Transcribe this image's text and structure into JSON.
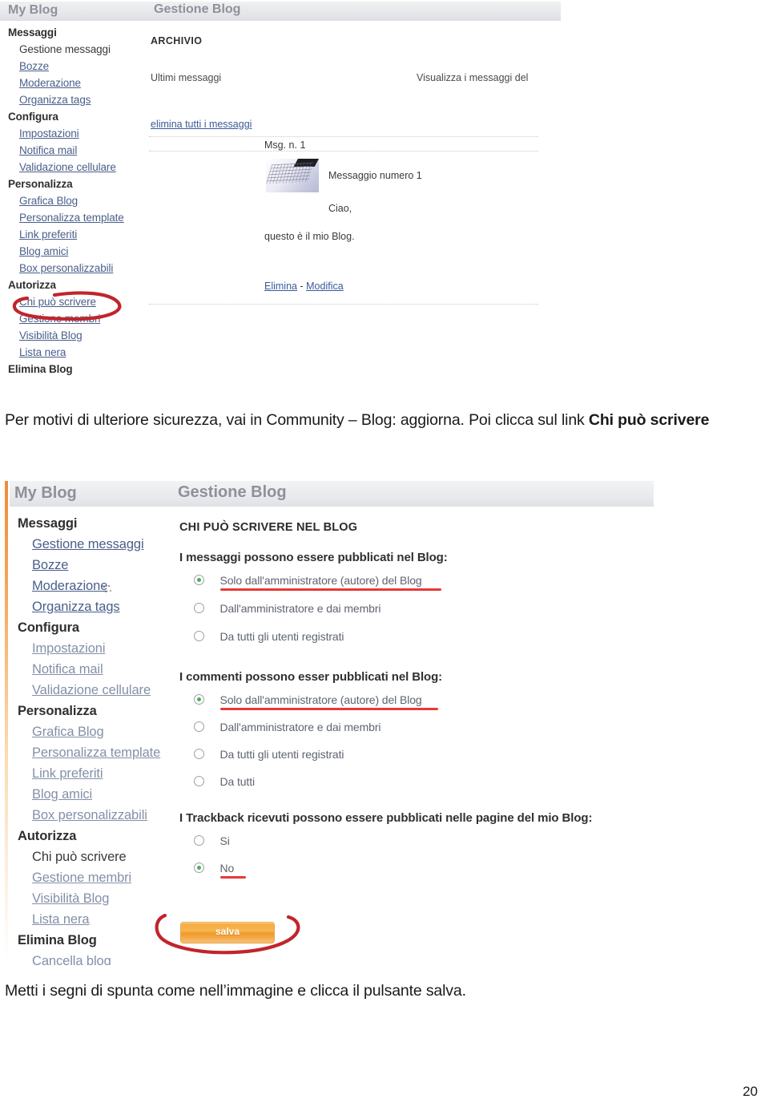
{
  "document": {
    "page_number": "20"
  },
  "colors": {
    "link": "#4a5f8a",
    "annotation_red": "#cc2a2a",
    "underline_red": "#e53a3a",
    "button_orange": "#f5a93f",
    "radio_green": "#4caf50",
    "title_grey": "#8d9199"
  },
  "caption1": {
    "part1": "Per motivi di ulteriore sicurezza, vai in Community – Blog: aggiorna. Poi clicca sul link ",
    "bold": "Chi può scrivere"
  },
  "caption2": {
    "text": "Metti i segni di spunta come nell’immagine e clicca il pulsante salva."
  },
  "screenshot1": {
    "titlebar": {
      "blog_title": "My Blog",
      "panel_title": "Gestione Blog"
    },
    "sidebar": [
      {
        "label": "Messaggi",
        "type": "head"
      },
      {
        "label": "Gestione messaggi",
        "type": "current"
      },
      {
        "label": "Bozze",
        "type": "link"
      },
      {
        "label": "Moderazione",
        "type": "link"
      },
      {
        "label": "Organizza tags",
        "type": "link"
      },
      {
        "label": "Configura",
        "type": "head"
      },
      {
        "label": "Impostazioni",
        "type": "link"
      },
      {
        "label": "Notifica mail",
        "type": "link"
      },
      {
        "label": "Validazione cellulare",
        "type": "link"
      },
      {
        "label": "Personalizza",
        "type": "head"
      },
      {
        "label": "Grafica Blog",
        "type": "link"
      },
      {
        "label": "Personalizza template",
        "type": "link"
      },
      {
        "label": "Link preferiti",
        "type": "link"
      },
      {
        "label": "Blog amici",
        "type": "link"
      },
      {
        "label": "Box personalizzabili",
        "type": "link"
      },
      {
        "label": "Autorizza",
        "type": "head"
      },
      {
        "label": "Chi può scrivere",
        "type": "link"
      },
      {
        "label": "Gestione membri",
        "type": "link"
      },
      {
        "label": "Visibilità Blog",
        "type": "link"
      },
      {
        "label": "Lista nera",
        "type": "link"
      },
      {
        "label": "Elimina Blog",
        "type": "head"
      }
    ],
    "main": {
      "archivio_heading": "ARCHIVIO",
      "ultimi_messaggi": "Ultimi messaggi",
      "visualizza": "Visualizza i messaggi del",
      "elimina_tutti": "elimina tutti i messaggi",
      "msg_number": "Msg. n. 1",
      "msg_title": "Messaggio numero 1",
      "msg_greeting": "Ciao,",
      "msg_body": "questo è il mio Blog.",
      "action_elimina": "Elimina",
      "action_separator": "-",
      "action_modifica": "Modifica",
      "thumbnail_name": "keyboard-photo-thumbnail"
    },
    "annotation": {
      "circled_item": "Chi può scrivere",
      "shape": "red-ellipse"
    }
  },
  "screenshot2": {
    "titlebar": {
      "blog_title": "My Blog",
      "panel_title": "Gestione Blog"
    },
    "sidebar": [
      {
        "label": "Messaggi",
        "type": "head"
      },
      {
        "label": "Gestione messaggi",
        "type": "link"
      },
      {
        "label": "Bozze",
        "type": "link"
      },
      {
        "label": "Moderazione",
        "type": "link"
      },
      {
        "label": "Organizza tags",
        "type": "link"
      },
      {
        "label": "Configura",
        "type": "head"
      },
      {
        "label": "Impostazioni",
        "type": "link"
      },
      {
        "label": "Notifica mail",
        "type": "link"
      },
      {
        "label": "Validazione cellulare",
        "type": "link"
      },
      {
        "label": "Personalizza",
        "type": "head"
      },
      {
        "label": "Grafica Blog",
        "type": "link"
      },
      {
        "label": "Personalizza template",
        "type": "link"
      },
      {
        "label": "Link preferiti",
        "type": "link"
      },
      {
        "label": "Blog amici",
        "type": "link"
      },
      {
        "label": "Box personalizzabili",
        "type": "link"
      },
      {
        "label": "Autorizza",
        "type": "head"
      },
      {
        "label": "Chi può scrivere",
        "type": "current"
      },
      {
        "label": "Gestione membri",
        "type": "link"
      },
      {
        "label": "Visibilità Blog",
        "type": "link"
      },
      {
        "label": "Lista nera",
        "type": "link"
      },
      {
        "label": "Elimina Blog",
        "type": "head"
      },
      {
        "label": "Cancella blog",
        "type": "link"
      }
    ],
    "main": {
      "section_title": "CHI PUÒ SCRIVERE NEL BLOG",
      "group_messaggi": {
        "label": "I messaggi possono essere pubblicati nel Blog:",
        "options": [
          {
            "label": "Solo dall'amministratore (autore) del Blog",
            "checked": true,
            "underlined": true
          },
          {
            "label": "Dall'amministratore e dai membri",
            "checked": false,
            "underlined": false
          },
          {
            "label": "Da tutti gli utenti registrati",
            "checked": false,
            "underlined": false
          }
        ]
      },
      "group_commenti": {
        "label": "I commenti possono esser pubblicati nel Blog:",
        "options": [
          {
            "label": "Solo dall'amministratore (autore) del Blog",
            "checked": true,
            "underlined": true
          },
          {
            "label": "Dall'amministratore e dai membri",
            "checked": false,
            "underlined": false
          },
          {
            "label": "Da tutti gli utenti registrati",
            "checked": false,
            "underlined": false
          },
          {
            "label": "Da tutti",
            "checked": false,
            "underlined": false
          }
        ]
      },
      "group_trackback": {
        "label": "I Trackback ricevuti possono essere pubblicati nelle pagine del mio Blog:",
        "options": [
          {
            "label": "Si",
            "checked": false,
            "underlined": false
          },
          {
            "label": "No",
            "checked": true,
            "underlined": true
          }
        ]
      },
      "save_button": "salva"
    },
    "annotation": {
      "circled_item": "salva",
      "shape": "red-ellipse"
    }
  }
}
